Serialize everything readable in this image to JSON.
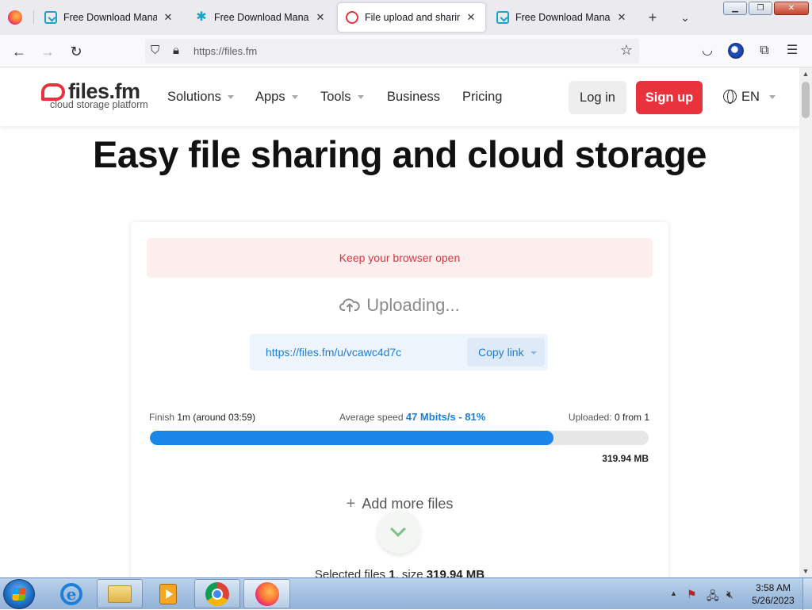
{
  "browser": {
    "tabs": [
      {
        "title": "Free Download Manager",
        "icon": "fdm-icon",
        "active": false
      },
      {
        "title": "Free Download Manager",
        "icon": "puzzle-icon",
        "active": false
      },
      {
        "title": "File upload and sharing.",
        "icon": "filesfm-icon",
        "active": true
      },
      {
        "title": "Free Download Manager",
        "icon": "fdm-icon",
        "active": false
      }
    ],
    "close_glyph": "✕",
    "new_tab_glyph": "+",
    "tab_list_glyph": "⌄",
    "window_buttons": {
      "minimize": "▁",
      "restore": "❐",
      "close": "✕"
    },
    "nav": {
      "back": "←",
      "forward": "→",
      "reload": "↻"
    },
    "url": "https://files.fm",
    "url_icons": [
      "shield-icon",
      "lock-icon"
    ],
    "bookmark_glyph": "☆",
    "toolbar_icons": [
      "pocket-icon",
      "account-icon",
      "extensions-icon",
      "menu-icon"
    ]
  },
  "site": {
    "logo": {
      "word": "files.fm",
      "tagline": "cloud storage platform"
    },
    "menu": [
      {
        "label": "Solutions",
        "has_dropdown": true
      },
      {
        "label": "Apps",
        "has_dropdown": true
      },
      {
        "label": "Tools",
        "has_dropdown": true
      },
      {
        "label": "Business",
        "has_dropdown": false
      },
      {
        "label": "Pricing",
        "has_dropdown": false
      }
    ],
    "login_label": "Log in",
    "signup_label": "Sign up",
    "language": "EN",
    "hero_title": "Easy file sharing and cloud storage"
  },
  "upload": {
    "alert": "Keep your browser open",
    "status": "Uploading...",
    "link": "https://files.fm/u/vcawc4d7c",
    "copy_label": "Copy link",
    "finish_label": "Finish",
    "finish_value": "1m (around 03:59)",
    "speed_label": "Average speed",
    "speed_value": "47 Mbits/s - 81%",
    "uploaded_label": "Uploaded:",
    "uploaded_value": "0 from 1",
    "progress_percent": 81,
    "total_size": "319.94 MB",
    "add_more": "Add more files",
    "selected_prefix": "Selected files",
    "selected_count": "1",
    "selected_size_label": ", size",
    "selected_size": "319.94 MB"
  },
  "colors": {
    "brand_red": "#e8323c",
    "link_blue": "#1a7fd4",
    "progress_blue": "#1a86e8"
  },
  "taskbar": {
    "apps": [
      "internet-explorer-icon",
      "file-explorer-icon",
      "media-player-icon",
      "chrome-icon",
      "firefox-icon"
    ],
    "time": "3:58 AM",
    "date": "5/26/2023"
  }
}
